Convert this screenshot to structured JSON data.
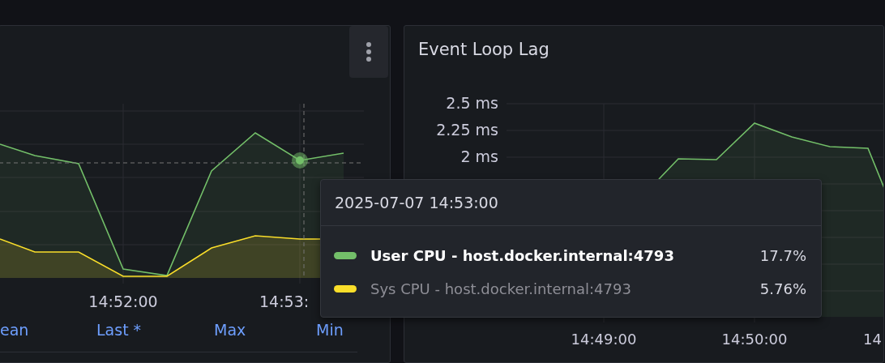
{
  "cpu_panel": {
    "x_axis": [
      "14:52:00",
      "14:53:"
    ],
    "legend_columns": [
      {
        "label": "ean"
      },
      {
        "label": "Last *"
      },
      {
        "label": "Max"
      },
      {
        "label": "Min"
      }
    ]
  },
  "event_loop_panel": {
    "title": "Event Loop Lag",
    "y_axis": [
      "2.5 ms",
      "2.25 ms",
      "2 ms"
    ],
    "x_axis": [
      "14:49:00",
      "14:50:00",
      "14"
    ]
  },
  "tooltip": {
    "time": "2025-07-07 14:53:00",
    "items": [
      {
        "name": "User CPU - host.docker.internal:4793",
        "value": "17.7%",
        "color": "#73bf69",
        "selected": true
      },
      {
        "name": "Sys CPU - host.docker.internal:4793",
        "value": "5.76%",
        "color": "#fade2a",
        "selected": false
      }
    ]
  }
}
